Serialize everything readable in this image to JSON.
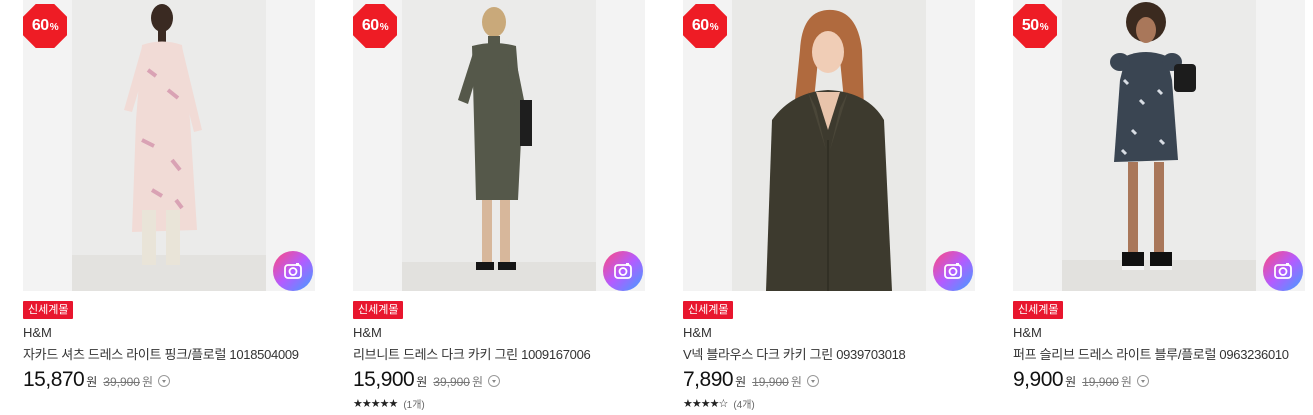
{
  "products": [
    {
      "discount": "60",
      "discount_unit": "%",
      "tag": "신세계몰",
      "brand": "H&M",
      "name": "자카드 셔츠 드레스 라이트 핑크/플로럴 1018504009",
      "price": "15,870",
      "price_unit": "원",
      "original_price": "39,900",
      "original_unit": "원",
      "stars": "",
      "review_count": ""
    },
    {
      "discount": "60",
      "discount_unit": "%",
      "tag": "신세계몰",
      "brand": "H&M",
      "name": "리브니트 드레스 다크 카키 그린 1009167006",
      "price": "15,900",
      "price_unit": "원",
      "original_price": "39,900",
      "original_unit": "원",
      "stars": "★★★★★",
      "review_count": "(1개)"
    },
    {
      "discount": "60",
      "discount_unit": "%",
      "tag": "신세계몰",
      "brand": "H&M",
      "name": "V넥 블라우스 다크 카키 그린 0939703018",
      "price": "7,890",
      "price_unit": "원",
      "original_price": "19,900",
      "original_unit": "원",
      "stars": "★★★★☆",
      "review_count": "(4개)"
    },
    {
      "discount": "50",
      "discount_unit": "%",
      "tag": "신세계몰",
      "brand": "H&M",
      "name": "퍼프 슬리브 드레스 라이트 블루/플로럴 0963236010",
      "price": "9,900",
      "price_unit": "원",
      "original_price": "19,900",
      "original_unit": "원",
      "stars": "",
      "review_count": ""
    }
  ],
  "colors": {
    "badge": "#ee1c25",
    "tag": "#e8162e"
  },
  "icons": {
    "image_search": "camera-search-icon",
    "info": "chevron-down-icon"
  }
}
